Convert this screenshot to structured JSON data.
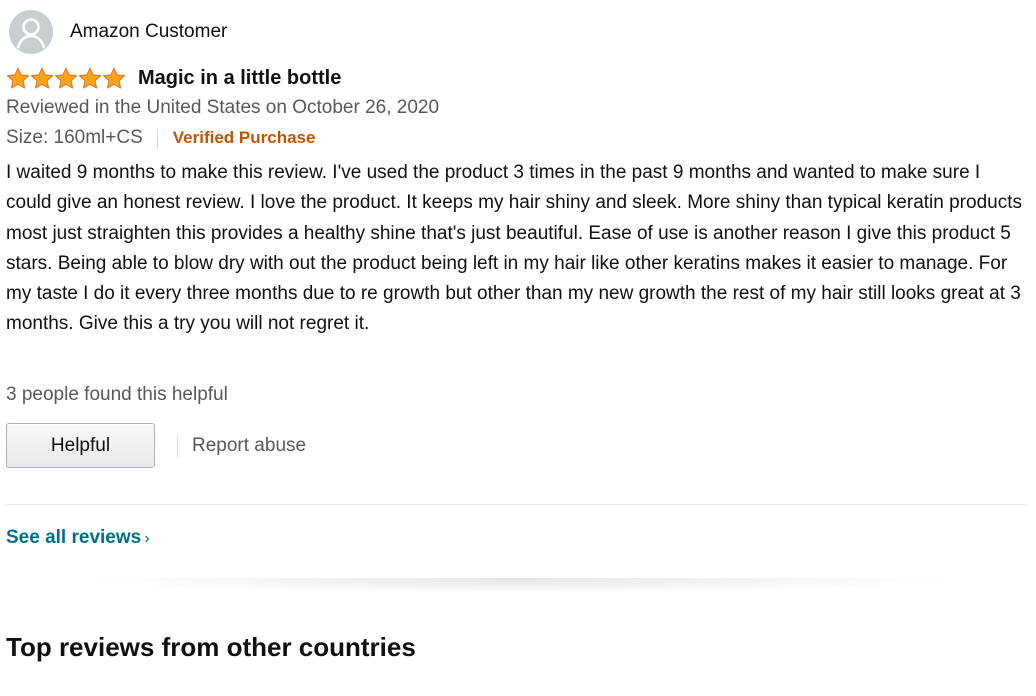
{
  "review": {
    "profile_name": "Amazon Customer",
    "avatar_icon": "user-silhouette-icon",
    "rating": 5,
    "rating_max": 5,
    "star_color": "#ffa41c",
    "title": "Magic in a little bottle",
    "date_line": "Reviewed in the United States on October 26, 2020",
    "format_strip": "Size: 160ml+CS",
    "verified_badge": "Verified Purchase",
    "body": "I waited 9 months to make this review. I've used the product 3 times in the past 9 months and wanted to make sure I could give an honest review. I love the product. It keeps my hair shiny and sleek. More shiny than typical keratin products most just straighten this provides a healthy shine that's just beautiful. Ease of use is another reason I give this product 5 stars. Being able to blow dry with out the product being left in my hair like other keratins makes it easier to manage. For my taste I do it every three months due to re growth but other than my new growth the rest of my hair still looks great at 3 months. Give this a try you will not regret it.",
    "helpful_count": "3 people found this helpful",
    "helpful_button": "Helpful",
    "report_link": "Report abuse"
  },
  "footer": {
    "see_all": "See all reviews",
    "see_all_chevron": "›",
    "section_title": "Top reviews from other countries"
  },
  "colors": {
    "link": "#007185",
    "verified": "#c45500",
    "muted": "#565959",
    "text": "#0f1111"
  }
}
